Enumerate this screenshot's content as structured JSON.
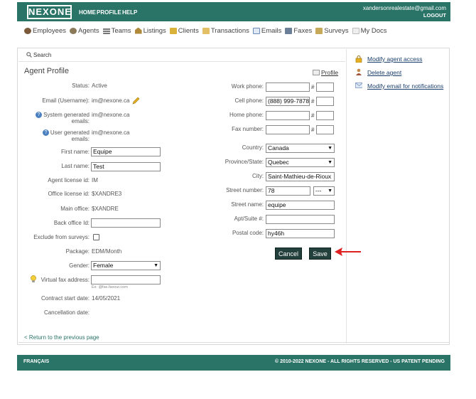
{
  "header": {
    "logo_text": "NEXONE",
    "nav": [
      "HOME",
      "PROFILE",
      "HELP"
    ],
    "user_email": "xandersonrealestate@gmail.com",
    "logout": "LOGOUT"
  },
  "modules": [
    {
      "label": "Employees",
      "icon": "employees-icon",
      "color": "#7a5a3a"
    },
    {
      "label": "Agents",
      "icon": "agents-icon",
      "color": "#8a7a5a"
    },
    {
      "label": "Teams",
      "icon": "teams-icon",
      "color": "#777777"
    },
    {
      "label": "Listings",
      "icon": "listings-icon",
      "color": "#b08a3a"
    },
    {
      "label": "Clients",
      "icon": "clients-icon",
      "color": "#d9b23a"
    },
    {
      "label": "Transactions",
      "icon": "transactions-icon",
      "color": "#e3c066"
    },
    {
      "label": "Emails",
      "icon": "emails-icon",
      "color": "#6b8ab8"
    },
    {
      "label": "Faxes",
      "icon": "faxes-icon",
      "color": "#6b7f99"
    },
    {
      "label": "Surveys",
      "icon": "surveys-icon",
      "color": "#c7a95a"
    },
    {
      "label": "My Docs",
      "icon": "my-docs-icon",
      "color": "#bdbdbd"
    }
  ],
  "search": {
    "label": "Search"
  },
  "profile": {
    "title": "Agent Profile",
    "profile_link": "Profile",
    "status_label": "Status:",
    "status_value": "Active",
    "email_label": "Email (Username):",
    "email_value": "im@nexone.ca",
    "sys_email_label": "System generated emails:",
    "sys_email_value": "im@nexone.ca",
    "user_email_label": "User generated emails:",
    "user_email_value": "im@nexone.ca",
    "first_name_label": "First name:",
    "first_name_value": "Equipe",
    "last_name_label": "Last name:",
    "last_name_value": "Test",
    "agent_license_label": "Agent license id:",
    "agent_license_value": "IM",
    "office_license_label": "Office license id:",
    "office_license_value": "$XANDRE3",
    "main_office_label": "Main office:",
    "main_office_value": "$XANDRE",
    "back_office_label": "Back office Id:",
    "back_office_value": "",
    "exclude_surveys_label": "Exclude from surveys:",
    "package_label": "Package:",
    "package_value": "EDM/Month",
    "gender_label": "Gender:",
    "gender_value": "Female",
    "virtual_fax_label": "Virtual fax address:",
    "virtual_fax_hint": "Ex: @fax.faxour.com",
    "contract_start_label": "Contract start date:",
    "contract_start_value": "14/05/2021",
    "cancellation_label": "Cancellation date:",
    "cancellation_value": "",
    "work_phone_label": "Work phone:",
    "cell_phone_label": "Cell phone:",
    "cell_phone_value": "(888) 999-7878",
    "home_phone_label": "Home phone:",
    "fax_number_label": "Fax number:",
    "hash": "#",
    "country_label": "Country:",
    "country_value": "Canada",
    "province_label": "Province/State:",
    "province_value": "Quebec",
    "city_label": "City:",
    "city_value": "Saint-Mathieu-de-Rioux",
    "street_number_label": "Street number:",
    "street_number_value": "78",
    "street_suffix_value": "---",
    "street_name_label": "Street name:",
    "street_name_value": "equipe",
    "apt_label": "Apt/Suite #:",
    "apt_value": "",
    "postal_label": "Postal code:",
    "postal_value": "hy46h",
    "cancel_button": "Cancel",
    "save_button": "Save",
    "back_link": "< Return to the previous page"
  },
  "sidebar": {
    "links": [
      {
        "label": "Modify agent access",
        "icon": "lock-icon"
      },
      {
        "label": "Delete agent",
        "icon": "delete-user-icon"
      },
      {
        "label": "Modify email for notifications",
        "icon": "email-icon"
      }
    ]
  },
  "footer": {
    "lang": "FRANÇAIS",
    "copyright": "© 2010-2022 NEXONE - ALL RIGHTS RESERVED - US PATENT PENDING"
  },
  "colors": {
    "brand": "#2a7367",
    "button": "#23403c",
    "link": "#1a3e6b",
    "arrow": "#e02020"
  }
}
